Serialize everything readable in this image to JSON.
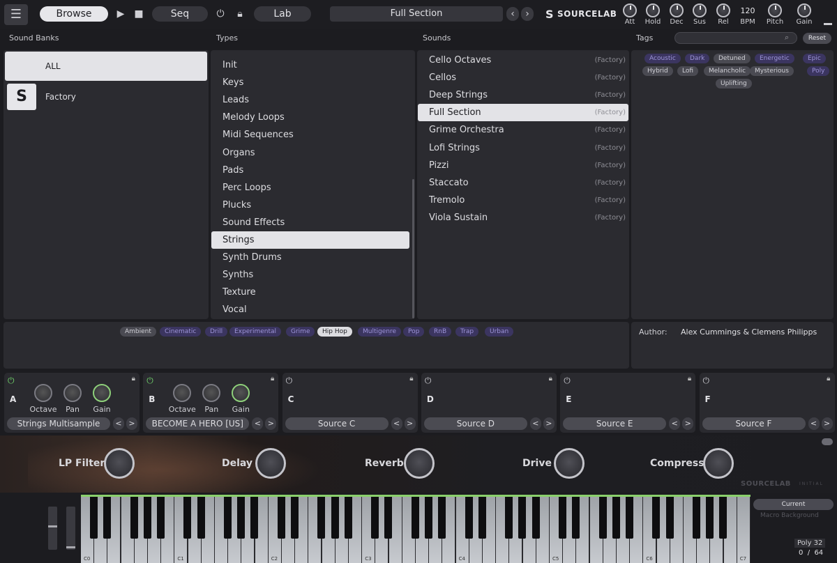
{
  "topbar": {
    "browse": "Browse",
    "seq": "Seq",
    "lab": "Lab",
    "preset": "Full Section",
    "brand": "SOURCELAB",
    "bpm_value": "120",
    "knobs": [
      "Att",
      "Hold",
      "Dec",
      "Sus",
      "Rel",
      "BPM",
      "Pitch",
      "Gain"
    ]
  },
  "headers": {
    "banks": "Sound Banks",
    "types": "Types",
    "sounds": "Sounds",
    "tags": "Tags"
  },
  "search": {
    "reset": "Reset"
  },
  "banks": [
    {
      "label": "ALL",
      "selected": true
    },
    {
      "label": "Factory",
      "selected": false
    }
  ],
  "types": [
    "Init",
    "Keys",
    "Leads",
    "Melody Loops",
    "Midi Sequences",
    "Organs",
    "Pads",
    "Perc Loops",
    "Plucks",
    "Sound Effects",
    "Strings",
    "Synth Drums",
    "Synths",
    "Texture",
    "Vocal"
  ],
  "types_selected": "Strings",
  "sounds": [
    {
      "name": "Cello Octaves",
      "tag": "(Factory)"
    },
    {
      "name": "Cellos",
      "tag": "(Factory)"
    },
    {
      "name": "Deep Strings",
      "tag": "(Factory)"
    },
    {
      "name": "Full Section",
      "tag": "(Factory)"
    },
    {
      "name": "Grime Orchestra",
      "tag": "(Factory)"
    },
    {
      "name": "Lofi Strings",
      "tag": "(Factory)"
    },
    {
      "name": "Pizzi",
      "tag": "(Factory)"
    },
    {
      "name": "Staccato",
      "tag": "(Factory)"
    },
    {
      "name": "Tremolo",
      "tag": "(Factory)"
    },
    {
      "name": "Viola Sustain",
      "tag": "(Factory)"
    }
  ],
  "sound_selected": "Full Section",
  "tags": [
    "Acoustic",
    "Dark",
    "Detuned",
    "Energetic",
    "Epic",
    "Hybrid",
    "Lofi",
    "Melancholic",
    "Mysterious",
    "Poly",
    "Uplifting"
  ],
  "genres": [
    "Ambient",
    "Cinematic",
    "Drill",
    "Experimental",
    "Grime",
    "Hip Hop",
    "Multigenre",
    "Pop",
    "RnB",
    "Trap",
    "Urban"
  ],
  "author": {
    "label": "Author:",
    "value": "Alex Cummings & Clemens Philipps"
  },
  "slots": [
    {
      "letter": "A",
      "source": "Strings Multisample",
      "active": true,
      "knobs": [
        "Octave",
        "Pan",
        "Gain"
      ]
    },
    {
      "letter": "B",
      "source": "BECOME A HERO [US]",
      "active": true,
      "knobs": [
        "Octave",
        "Pan",
        "Gain"
      ]
    },
    {
      "letter": "C",
      "source": "Source C",
      "active": false
    },
    {
      "letter": "D",
      "source": "Source D",
      "active": false
    },
    {
      "letter": "E",
      "source": "Source E",
      "active": false
    },
    {
      "letter": "F",
      "source": "Source F",
      "active": false
    }
  ],
  "macros": [
    "LP Filter",
    "Delay",
    "Reverb",
    "Drive",
    "Compress"
  ],
  "macro_brand": "SOURCELAB",
  "macro_brand_sub": "INITIAL",
  "keyboard": {
    "octaves": [
      "C0",
      "C1",
      "C2",
      "C3",
      "C4",
      "C5",
      "C6",
      "C7"
    ],
    "current": "Current",
    "macro_bg": "Macro Background",
    "poly": "Poly 32",
    "count": "0  /  64"
  },
  "colors": {
    "accent_green": "#8ad06b",
    "tag_purple": "#3b3560",
    "selected": "#e3e3e7"
  }
}
